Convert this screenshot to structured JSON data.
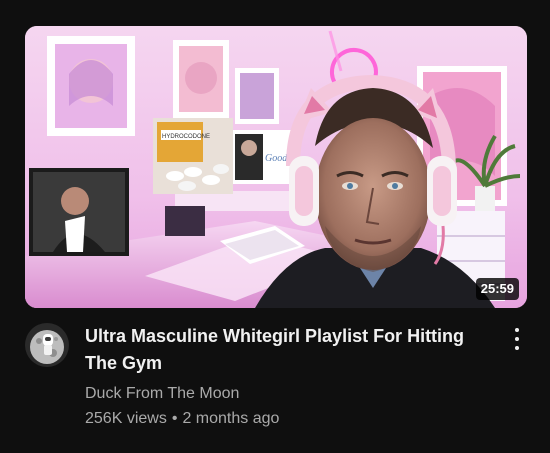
{
  "video": {
    "duration": "25:59",
    "title": "Ultra Masculine Whitegirl Playlist For Hitting The Gym",
    "channel": "Duck From The Moon",
    "views": "256K views",
    "separator": "•",
    "age": "2 months ago"
  },
  "thumbnail_text": {
    "book_title": "Good",
    "pill_label": "HYDROCODONE"
  },
  "icons": {
    "menu": "more-vert-icon",
    "avatar": "astronaut-avatar"
  },
  "colors": {
    "background": "#0f0f0f",
    "title": "#f1f1f1",
    "secondary": "#aaaaaa",
    "neon": "#ff5ad6"
  }
}
